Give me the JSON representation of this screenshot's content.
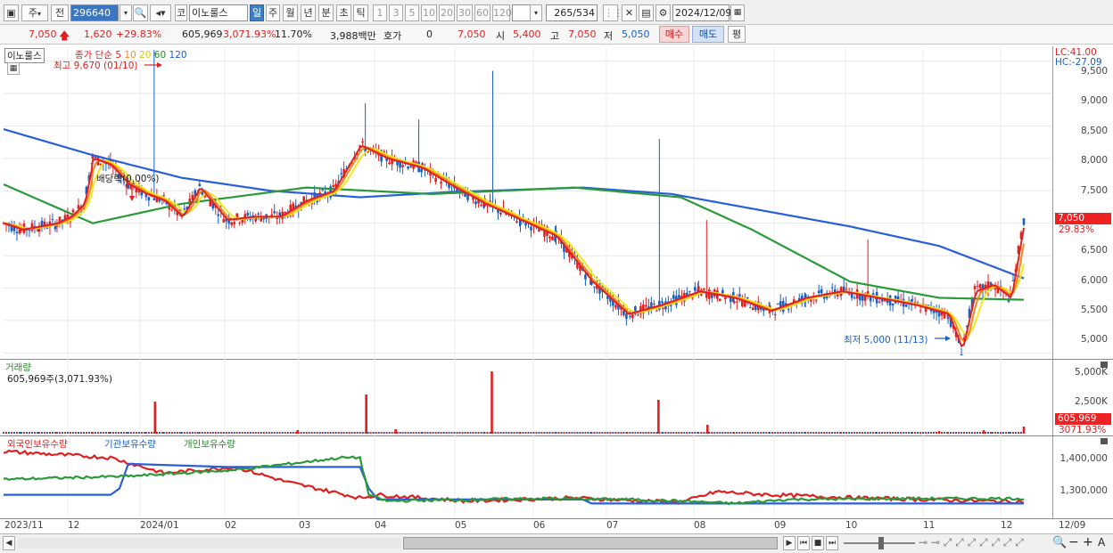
{
  "toolbar": {
    "market_btn": "주",
    "prev_btn": "전",
    "code": "296640",
    "market2": "코",
    "name": "이노룰스",
    "period_day": "일",
    "period_week": "주",
    "period_month": "월",
    "period_year": "년",
    "period_min": "분",
    "period_sec": "초",
    "period_tick": "틱",
    "intervals": [
      "1",
      "3",
      "5",
      "10",
      "20",
      "30",
      "60",
      "120"
    ],
    "count": "265",
    "total": "/534",
    "date": "2024/12/09"
  },
  "quote": {
    "price": "7,050",
    "change": "1,620",
    "change_pct": "+29.83%",
    "volume": "605,969",
    "vol_pct": "3,071.93%",
    "turnover_pct": "11.70%",
    "amount": "3,988백만",
    "hoga_label": "호가",
    "hoga_val": "0",
    "hoga_price": "7,050",
    "open_label": "시",
    "open": "5,400",
    "high_label": "고",
    "high": "7,050",
    "low_label": "저",
    "low": "5,050",
    "buy_btn": "매수",
    "sell_btn": "매도",
    "avg_btn": "평"
  },
  "price_panel": {
    "stock_tag": "이노룰스",
    "legend_label": "종가 단순",
    "ma": [
      "5",
      "10",
      "20",
      "60",
      "120"
    ],
    "lc": "LC:41.00",
    "hc": "HC:-27.09",
    "max_note": "최고 9,670 (01/10)",
    "min_note": "최저 5,000 (11/13)",
    "dividend_note": "배당락(0.00%)",
    "current_tag": "7,050",
    "current_pct": "29.83%",
    "y_ticks": [
      "9,500",
      "9,000",
      "8,500",
      "8,000",
      "7,500",
      "7,000",
      "6,500",
      "6,000",
      "5,500",
      "5,000"
    ]
  },
  "volume_panel": {
    "title": "거래량",
    "value_note": "605,969주(3,071.93%)",
    "y_ticks": [
      "5,000K",
      "2,500K"
    ],
    "current_tag": "605,969",
    "current_pct": "3071.93%"
  },
  "holdings_panel": {
    "legend": [
      "외국인보유수량",
      "기관보유수량",
      "개인보유수량"
    ],
    "y_ticks": [
      "1,400,000",
      "1,300,000"
    ]
  },
  "x_labels": [
    "2023/11",
    "12",
    "2024/01",
    "02",
    "03",
    "04",
    "05",
    "06",
    "07",
    "08",
    "09",
    "10",
    "11",
    "12",
    "12/09"
  ],
  "colors": {
    "up": "#e02020",
    "down": "#1a5fc0",
    "ma5": "#e02020",
    "ma10": "#f08a1c",
    "ma20": "#f2e81c",
    "ma60": "#2a9a3a",
    "ma120": "#2a5fd8"
  },
  "chart_data": {
    "type": "candlestick",
    "title": "이노룰스",
    "x_range": [
      "2023/11",
      "2024/12/09"
    ],
    "ylim": [
      4950,
      9700
    ],
    "approx_close": [
      [
        0,
        7000
      ],
      [
        20,
        6900
      ],
      [
        40,
        6950
      ],
      [
        60,
        7000
      ],
      [
        75,
        7100
      ],
      [
        90,
        7300
      ],
      [
        100,
        8000
      ],
      [
        120,
        7900
      ],
      [
        140,
        7600
      ],
      [
        160,
        7450
      ],
      [
        180,
        7350
      ],
      [
        200,
        7100
      ],
      [
        220,
        7550
      ],
      [
        250,
        7050
      ],
      [
        280,
        7100
      ],
      [
        310,
        7100
      ],
      [
        340,
        7350
      ],
      [
        370,
        7500
      ],
      [
        400,
        8200
      ],
      [
        430,
        8000
      ],
      [
        470,
        7850
      ],
      [
        500,
        7600
      ],
      [
        540,
        7300
      ],
      [
        580,
        7050
      ],
      [
        620,
        6800
      ],
      [
        660,
        6100
      ],
      [
        700,
        5600
      ],
      [
        740,
        5750
      ],
      [
        780,
        5950
      ],
      [
        820,
        5850
      ],
      [
        860,
        5650
      ],
      [
        900,
        5850
      ],
      [
        940,
        5950
      ],
      [
        980,
        5850
      ],
      [
        1020,
        5750
      ],
      [
        1060,
        5600
      ],
      [
        1075,
        5050
      ],
      [
        1090,
        5950
      ],
      [
        1110,
        6050
      ],
      [
        1130,
        5850
      ],
      [
        1145,
        7050
      ]
    ],
    "ma120": [
      [
        0,
        8450
      ],
      [
        100,
        8050
      ],
      [
        200,
        7700
      ],
      [
        300,
        7500
      ],
      [
        400,
        7400
      ],
      [
        500,
        7480
      ],
      [
        650,
        7550
      ],
      [
        750,
        7450
      ],
      [
        850,
        7200
      ],
      [
        950,
        6950
      ],
      [
        1050,
        6650
      ],
      [
        1145,
        6150
      ]
    ],
    "ma60": [
      [
        0,
        7600
      ],
      [
        100,
        7000
      ],
      [
        200,
        7300
      ],
      [
        340,
        7550
      ],
      [
        480,
        7450
      ],
      [
        640,
        7550
      ],
      [
        760,
        7400
      ],
      [
        840,
        6900
      ],
      [
        950,
        6100
      ],
      [
        1050,
        5850
      ],
      [
        1145,
        5820
      ]
    ],
    "holdings_levels": {
      "foreign": [
        1440000,
        1290000,
        1280000,
        1285000
      ],
      "institution": [
        1300000,
        1400000,
        1270000,
        1280000
      ],
      "individual": [
        1350000,
        1420000,
        1280000,
        1270000
      ]
    },
    "volume_spikes": [
      {
        "x": 170,
        "v": "~3000K"
      },
      {
        "x": 407,
        "v": "~2600K"
      },
      {
        "x": 548,
        "v": "~5000K"
      },
      {
        "x": 735,
        "v": "~2500K"
      },
      {
        "x": 1145,
        "v": "605,969"
      }
    ]
  }
}
